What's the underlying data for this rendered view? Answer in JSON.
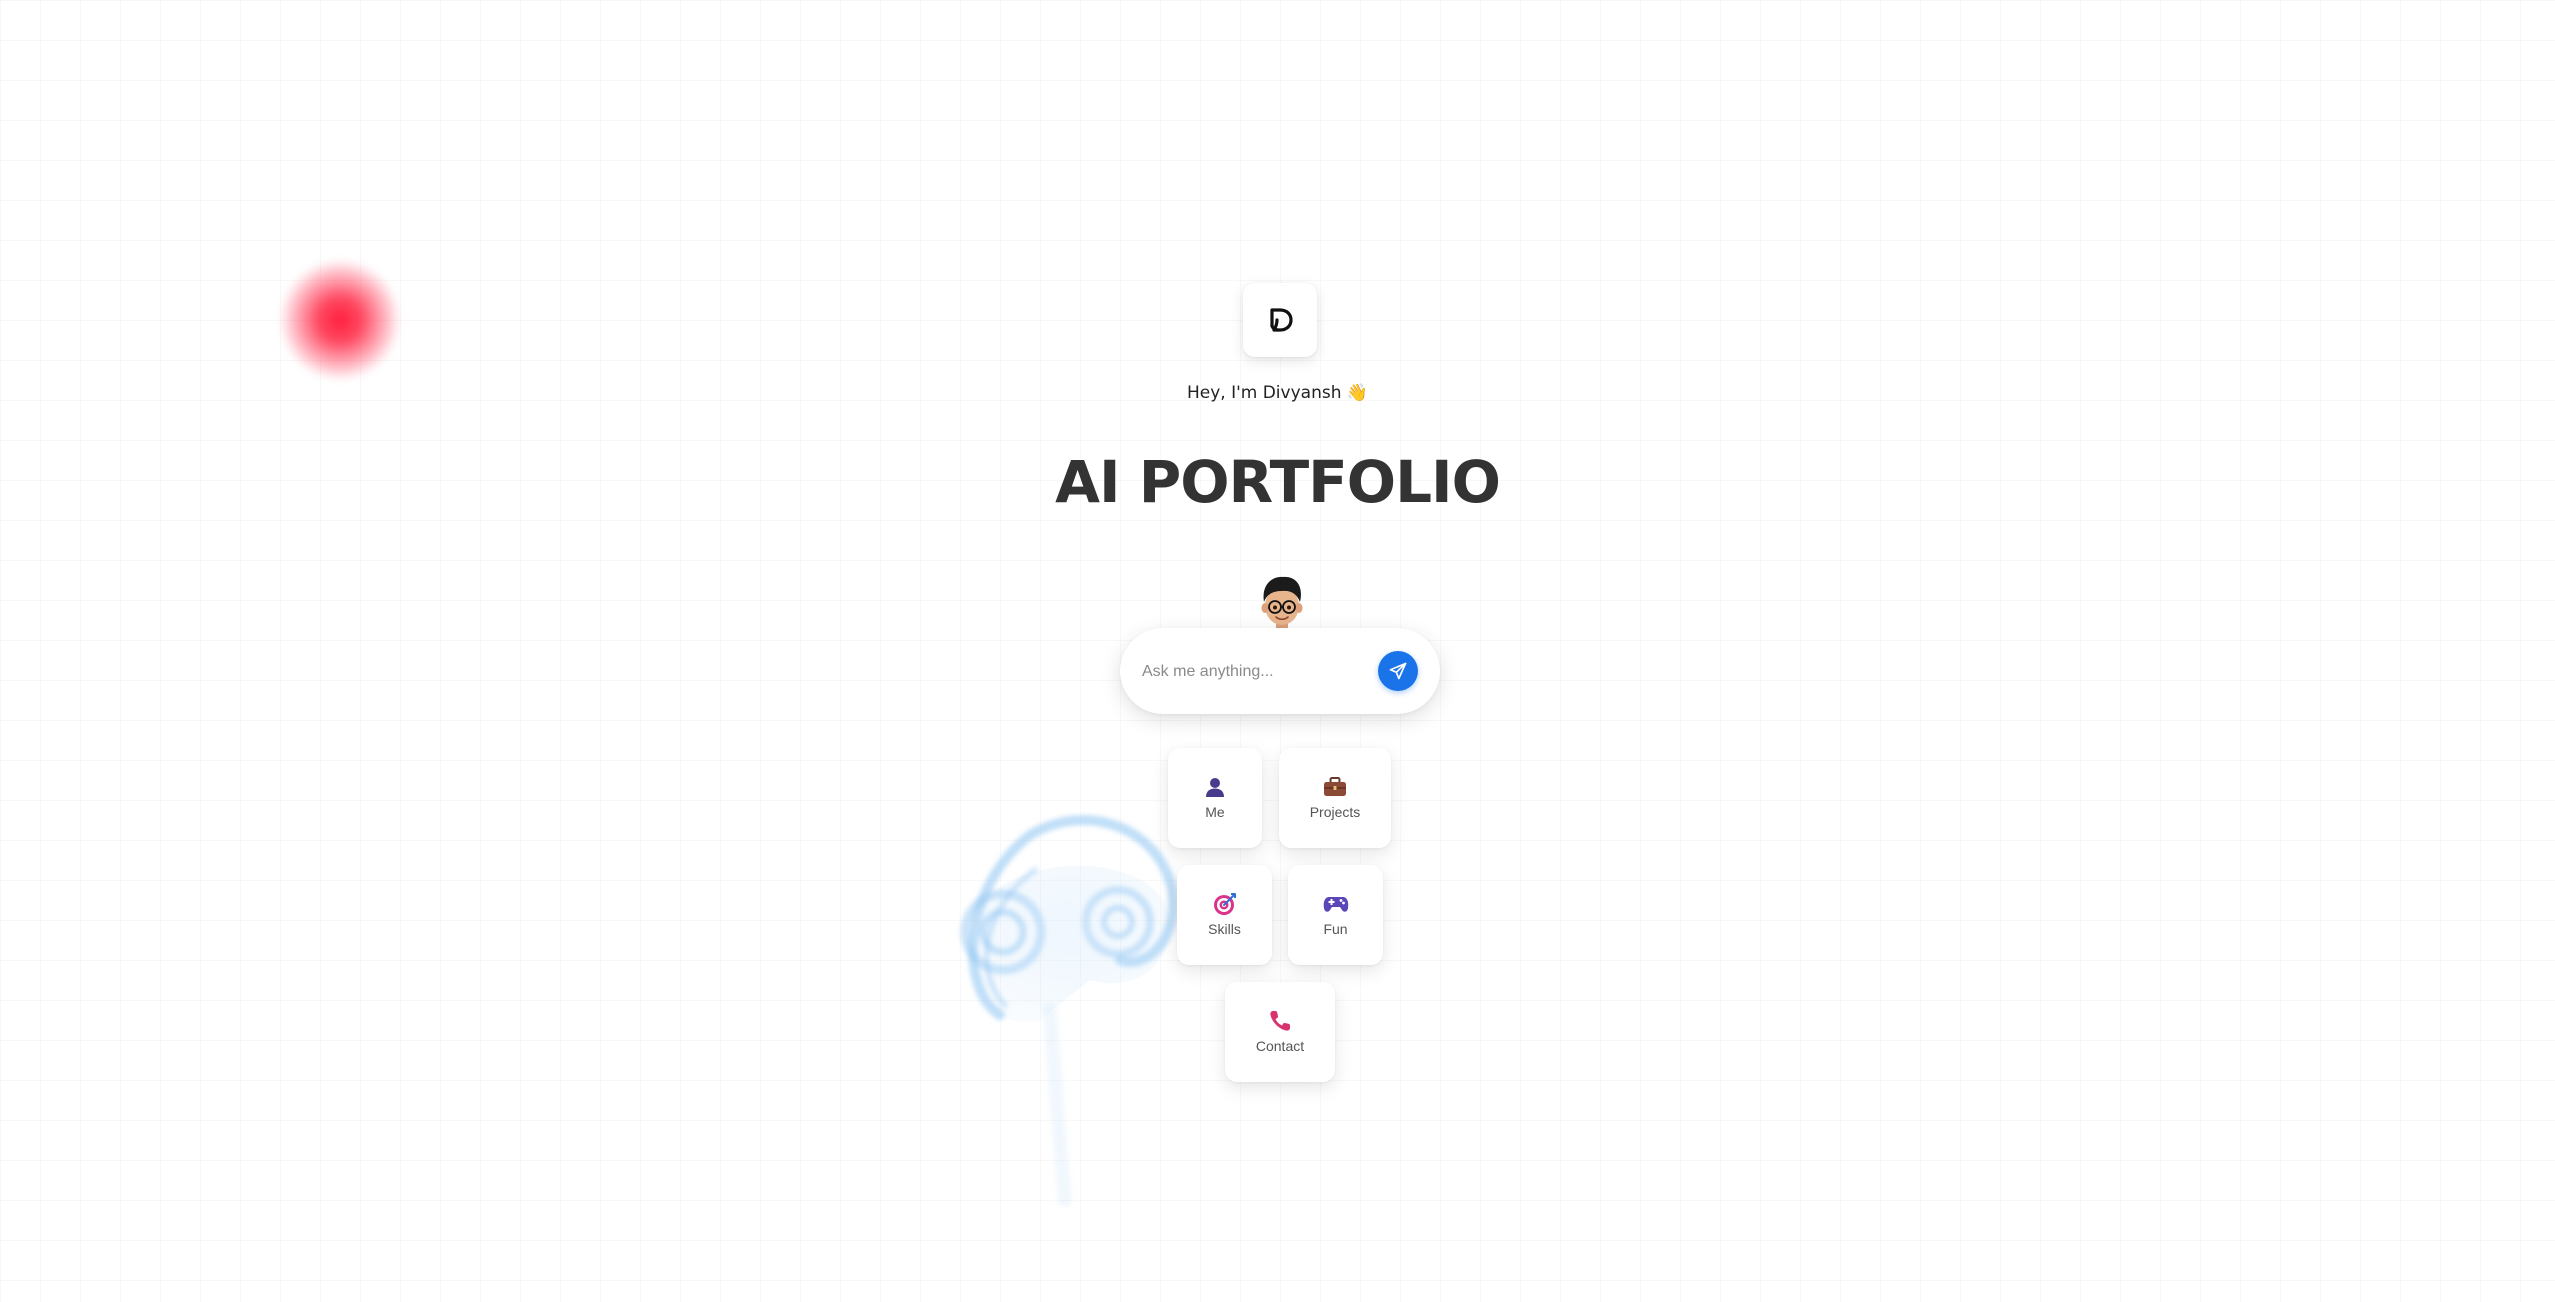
{
  "hero": {
    "logo_letter": "D",
    "greeting": "Hey, I'm Divyansh 👋",
    "headline": "AI PORTFOLIO"
  },
  "search": {
    "placeholder": "Ask me anything...",
    "value": ""
  },
  "quick_actions": [
    {
      "label": "Me",
      "icon": "person-icon"
    },
    {
      "label": "Projects",
      "icon": "briefcase-icon"
    },
    {
      "label": "Skills",
      "icon": "target-icon"
    },
    {
      "label": "Fun",
      "icon": "game-controller-icon"
    },
    {
      "label": "Contact",
      "icon": "phone-icon"
    }
  ],
  "colors": {
    "accent": "#1a73e8",
    "headline": "#333333",
    "red_blob": "#ff1f3d",
    "swirl": "#8ec4f2"
  }
}
